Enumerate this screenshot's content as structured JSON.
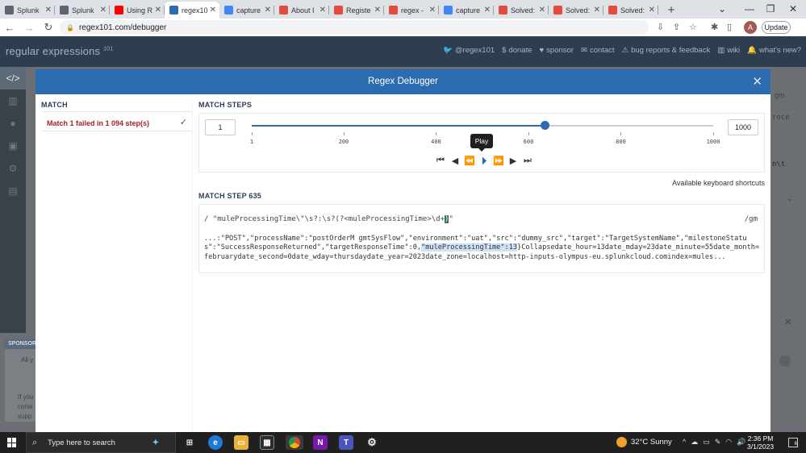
{
  "browser": {
    "tabs": [
      {
        "label": "Splunk",
        "icon": "splunk-icon",
        "color": "#5c6670"
      },
      {
        "label": "Splunk",
        "icon": "splunk-icon",
        "color": "#5c6670"
      },
      {
        "label": "Using R",
        "icon": "youtube-icon",
        "color": "#ff0000"
      },
      {
        "label": "regex10",
        "icon": "regex101-icon",
        "color": "#2b6cb0",
        "active": true
      },
      {
        "label": "capture",
        "icon": "google-icon",
        "color": "#4285f4"
      },
      {
        "label": "About I",
        "icon": "splunk-community-icon",
        "color": "#e34b3c"
      },
      {
        "label": "Registe",
        "icon": "splunk-community-icon",
        "color": "#e34b3c"
      },
      {
        "label": "regex -",
        "icon": "splunk-community-icon",
        "color": "#e34b3c"
      },
      {
        "label": "capture",
        "icon": "google-icon",
        "color": "#4285f4"
      },
      {
        "label": "Solved:",
        "icon": "splunk-community-icon",
        "color": "#e34b3c"
      },
      {
        "label": "Solved:",
        "icon": "splunk-community-icon",
        "color": "#e34b3c"
      },
      {
        "label": "Solved:",
        "icon": "splunk-community-icon",
        "color": "#e34b3c"
      }
    ],
    "url": "regex101.com/debugger",
    "avatar_letter": "A",
    "update_label": "Update"
  },
  "site": {
    "logo_main": "regular expressions",
    "logo_version": "101",
    "nav": [
      "@regex101",
      "donate",
      "sponsor",
      "contact",
      "bug reports & feedback",
      "wiki",
      "what's new?"
    ]
  },
  "background": {
    "sponsor_label": "SPONSOR",
    "sponsor_line1": "All y",
    "sponsor_line2": [
      "If you",
      "consi",
      "supp"
    ],
    "right_fragments": [
      "gm",
      "roce",
      "n\\t"
    ]
  },
  "modal": {
    "title": "Regex Debugger",
    "match_label": "MATCH",
    "match_result": "Match 1 failed in 1 094 step(s)",
    "steps_label": "MATCH STEPS",
    "step_min": "1",
    "step_max": "1000",
    "slider_min": 1,
    "slider_max": 1000,
    "slider_value": 635,
    "ticks": [
      "1",
      "200",
      "400",
      "600",
      "800",
      "1000"
    ],
    "tooltip": "Play",
    "kb_shortcuts": "Available keyboard shortcuts",
    "step_heading": "MATCH STEP 635",
    "regex_prefix": "/ \"muleProcessingTime\\\"\\s?:\\s?(?<muleProcessingTime>\\d+",
    "regex_hl": ")",
    "regex_suffix": "\"",
    "regex_flags": "/gm",
    "text_before": "...:\"POST\",\"processName\":\"postOrderM gmtSysFlow\",\"environment\":\"uat\",\"src\":\"dummy_src\",\"target\":\"TargetSystemName\",\"milestoneStatus\":\"SuccessResponseReturned\",\"targetResponseTime\":0,",
    "text_match": "\"muleProcessingTime\":13",
    "text_after": "}Collapsedate_hour=13date_mday=23date_minute=55date_month=februarydate_second=0date_wday=thursdaydate_year=2023date_zone=localhost=http-inputs-olympus-eu.splunkcloud.comindex=mules..."
  },
  "taskbar": {
    "search_placeholder": "Type here to search",
    "weather": "32°C  Sunny",
    "time": "2:36 PM",
    "date": "3/1/2023",
    "notifications": "6"
  }
}
